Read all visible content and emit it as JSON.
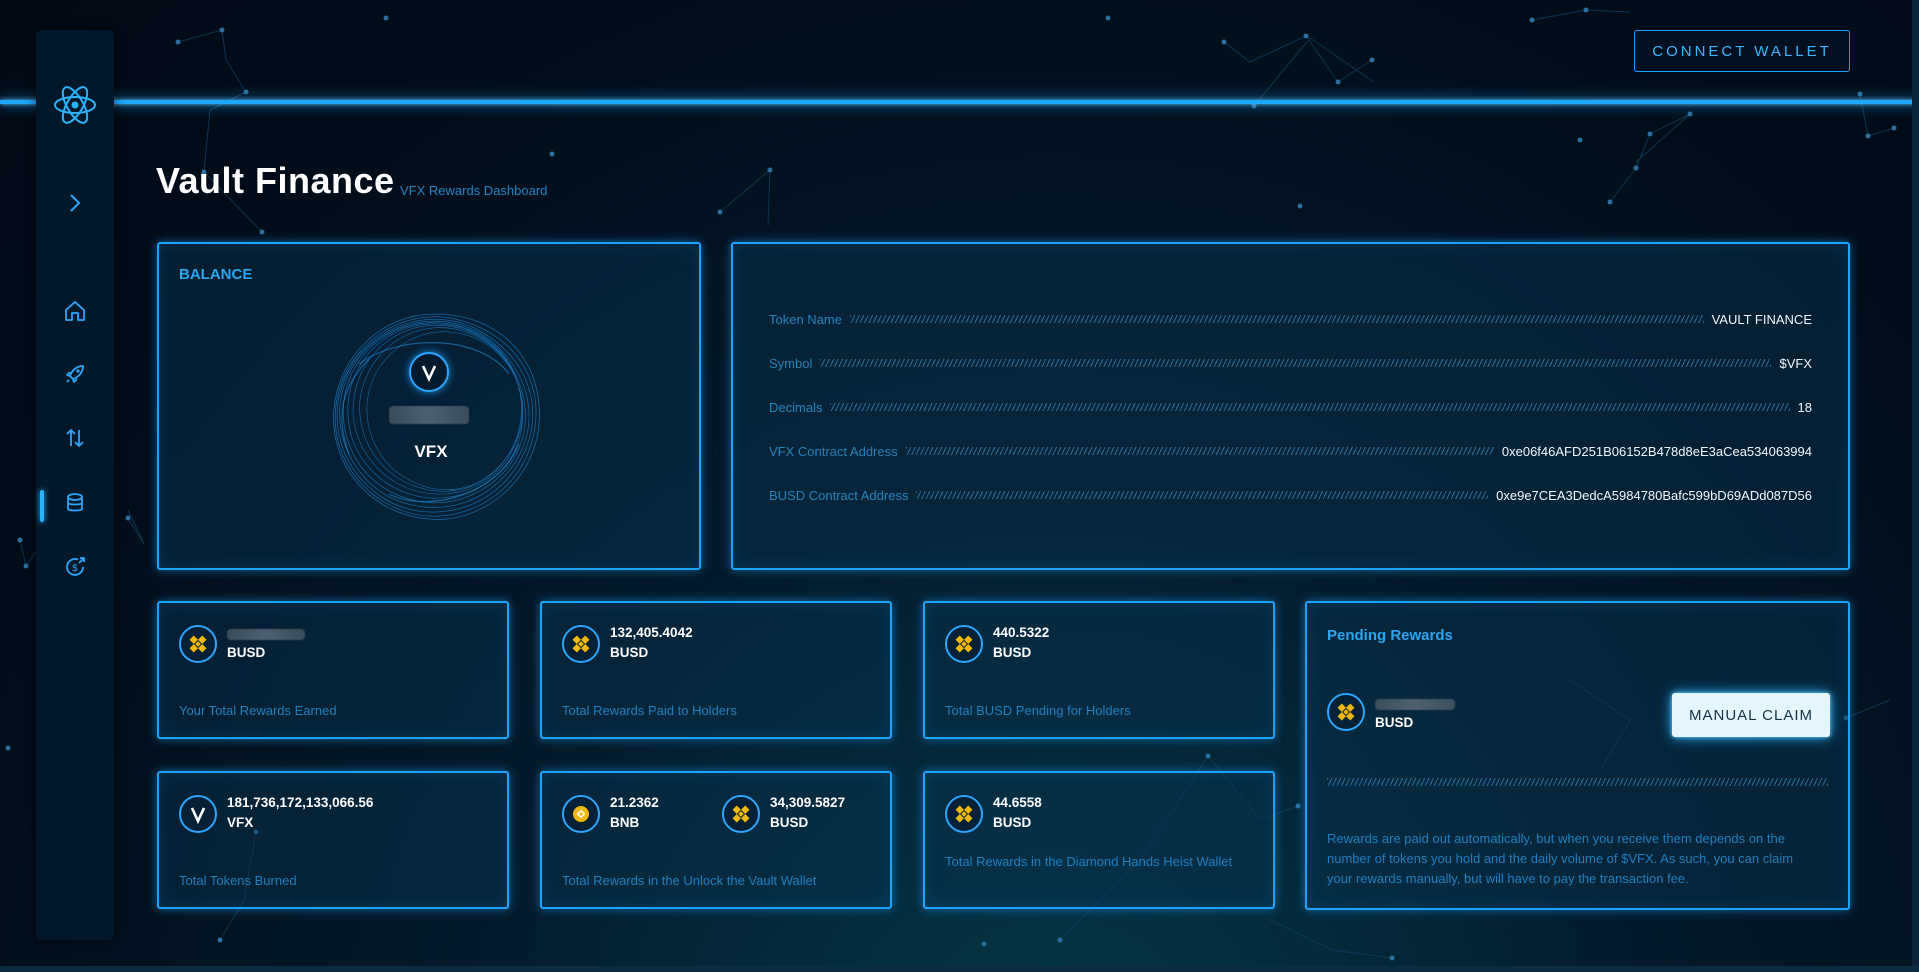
{
  "header": {
    "title": "Vault Finance",
    "subtitle": "VFX Rewards Dashboard",
    "connect_label": "CONNECT WALLET"
  },
  "sidebar": {
    "items": [
      {
        "icon": "chevron-right-icon"
      },
      {
        "icon": "home-icon"
      },
      {
        "icon": "rocket-icon"
      },
      {
        "icon": "swap-arrows-icon"
      },
      {
        "icon": "coins-stack-icon",
        "active": true
      },
      {
        "icon": "dollar-cycle-icon"
      }
    ]
  },
  "balance": {
    "label": "BALANCE",
    "token": "VFX",
    "coin_letter": "V"
  },
  "token_info": {
    "rows": [
      {
        "key": "Token Name",
        "value": "VAULT FINANCE"
      },
      {
        "key": "Symbol",
        "value": "$VFX"
      },
      {
        "key": "Decimals",
        "value": "18"
      },
      {
        "key": "VFX Contract Address",
        "value": "0xe06f46AFD251B06152B478d8eE3aCea534063994"
      },
      {
        "key": "BUSD Contract Address",
        "value": "0xe9e7CEA3DedcA5984780Bafc599bD69ADd087D56"
      }
    ]
  },
  "stats": {
    "your_rewards": {
      "value": "",
      "unit": "BUSD",
      "label": "Your Total Rewards Earned"
    },
    "paid_to_holders": {
      "value": "132,405.4042",
      "unit": "BUSD",
      "label": "Total Rewards Paid to Holders"
    },
    "pending_for_holders": {
      "value": "440.5322",
      "unit": "BUSD",
      "label": "Total BUSD Pending for Holders"
    },
    "tokens_burned": {
      "value": "181,736,172,133,066.56",
      "unit": "VFX",
      "label": "Total Tokens Burned",
      "coin_letter": "V"
    },
    "unlock_vault": {
      "bnb_value": "21.2362",
      "bnb_unit": "BNB",
      "busd_value": "34,309.5827",
      "busd_unit": "BUSD",
      "label": "Total Rewards in the Unlock the Vault Wallet"
    },
    "diamond_hands": {
      "value": "44.6558",
      "unit": "BUSD",
      "label": "Total Rewards in the Diamond Hands Heist Wallet"
    }
  },
  "pending": {
    "title": "Pending Rewards",
    "unit": "BUSD",
    "claim_label": "MANUAL CLAIM",
    "note": "Rewards are paid out automatically, but when you receive them depends on the number of tokens you hold and the daily volume of $VFX. As such, you can claim your rewards manually, but will have to pay the transaction fee."
  },
  "colors": {
    "accent": "#1aa4ff",
    "background": "#020d1a",
    "busd": "#f0b90b"
  }
}
